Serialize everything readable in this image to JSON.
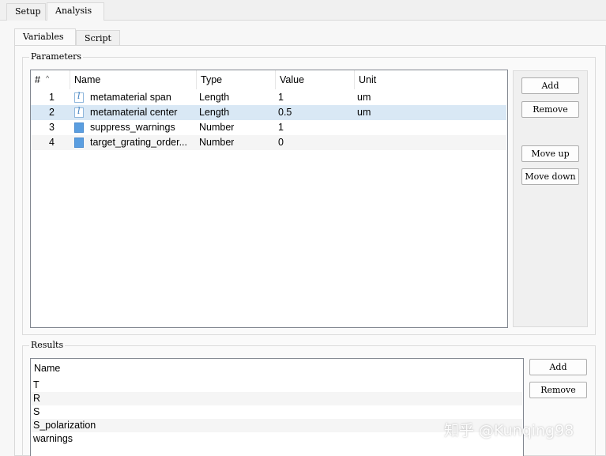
{
  "tabs": [
    {
      "label": "Setup",
      "active": false
    },
    {
      "label": "Analysis",
      "active": true
    }
  ],
  "subtabs": [
    {
      "label": "Variables",
      "active": true
    },
    {
      "label": "Script",
      "active": false
    }
  ],
  "parameters": {
    "title": "Parameters",
    "columns": [
      "#",
      "Name",
      "Type",
      "Value",
      "Unit"
    ],
    "rows": [
      {
        "num": "1",
        "name": "metamaterial span",
        "type": "Length",
        "value": "1",
        "unit": "um",
        "icon": "length-variable-icon"
      },
      {
        "num": "2",
        "name": "metamaterial center",
        "type": "Length",
        "value": "0.5",
        "unit": "um",
        "icon": "length-variable-icon"
      },
      {
        "num": "3",
        "name": "suppress_warnings",
        "type": "Number",
        "value": "1",
        "unit": "",
        "icon": "number-variable-icon"
      },
      {
        "num": "4",
        "name": "target_grating_order...",
        "type": "Number",
        "value": "0",
        "unit": "",
        "icon": "number-variable-icon"
      }
    ],
    "selected_row": 2,
    "buttons": {
      "add": "Add",
      "remove": "Remove",
      "move_up": "Move up",
      "move_down": "Move down"
    }
  },
  "results": {
    "title": "Results",
    "column": "Name",
    "rows": [
      "T",
      "R",
      "S",
      "S_polarization",
      "warnings"
    ],
    "buttons": {
      "add": "Add",
      "remove": "Remove"
    }
  },
  "watermark": "知乎 @Kunqing98",
  "colors": {
    "selection": "#d9e8f5",
    "number_icon": "#5a9ee0",
    "length_icon": "#3c7dbd"
  }
}
